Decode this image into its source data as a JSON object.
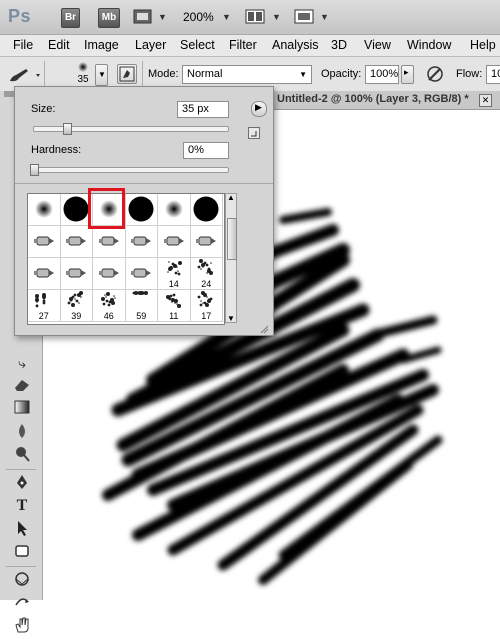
{
  "app": {
    "logo": "Ps",
    "bridge_label": "Br",
    "minibridge_label": "Mb",
    "zoom": "200%"
  },
  "menu": [
    "File",
    "Edit",
    "Image",
    "Layer",
    "Select",
    "Filter",
    "Analysis",
    "3D",
    "View",
    "Window",
    "Help"
  ],
  "options": {
    "brush_size": "35",
    "mode_label": "Mode:",
    "mode_value": "Normal",
    "opacity_label": "Opacity:",
    "opacity_value": "100%",
    "flow_label": "Flow:",
    "flow_value": "10"
  },
  "document_tab": {
    "title": "Untitled-2 @ 100% (Layer 3, RGB/8) *"
  },
  "brush_picker": {
    "size_label": "Size:",
    "size_value": "35 px",
    "size_fraction": 0.17,
    "hardness_label": "Hardness:",
    "hardness_value": "0%",
    "hardness_fraction": 0.0,
    "presets": [
      {
        "kind": "soft",
        "num": ""
      },
      {
        "kind": "hard",
        "num": ""
      },
      {
        "kind": "soft",
        "num": ""
      },
      {
        "kind": "hard",
        "num": ""
      },
      {
        "kind": "soft",
        "num": ""
      },
      {
        "kind": "hard",
        "num": ""
      },
      {
        "kind": "pen",
        "num": ""
      },
      {
        "kind": "pen",
        "num": ""
      },
      {
        "kind": "pen",
        "num": ""
      },
      {
        "kind": "pen",
        "num": ""
      },
      {
        "kind": "pen",
        "num": ""
      },
      {
        "kind": "pen",
        "num": ""
      },
      {
        "kind": "pen",
        "num": ""
      },
      {
        "kind": "pen",
        "num": ""
      },
      {
        "kind": "pen",
        "num": ""
      },
      {
        "kind": "pen",
        "num": ""
      },
      {
        "kind": "scatter",
        "num": "14"
      },
      {
        "kind": "scatter",
        "num": "24"
      },
      {
        "kind": "scatter",
        "num": "27"
      },
      {
        "kind": "scatter",
        "num": "39"
      },
      {
        "kind": "scatter",
        "num": "46"
      },
      {
        "kind": "scatter",
        "num": "59"
      },
      {
        "kind": "scatter",
        "num": "11"
      },
      {
        "kind": "scatter",
        "num": "17"
      }
    ],
    "selected_index": 2,
    "selection_color": "#e0141e"
  },
  "colors": {
    "accent": "#e0141e"
  }
}
